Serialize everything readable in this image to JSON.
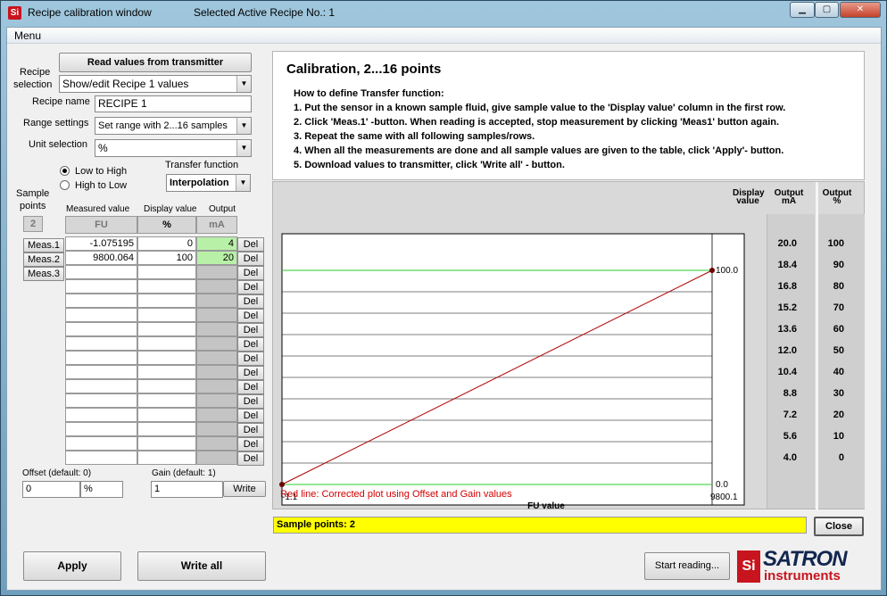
{
  "window": {
    "title": "Recipe calibration window",
    "active_recipe_label": "Selected Active Recipe No.: 1",
    "minimize": "▁",
    "maximize": "▢",
    "close": "✕"
  },
  "menu": {
    "label": "Menu"
  },
  "left": {
    "read_button": "Read values from transmitter",
    "recipe_selection_label_1": "Recipe",
    "recipe_selection_label_2": "selection",
    "recipe_selection_value": "Show/edit Recipe 1 values",
    "recipe_name_label": "Recipe name",
    "recipe_name_value": "RECIPE 1",
    "range_settings_label": "Range settings",
    "range_settings_value": "Set range with 2...16 samples",
    "unit_selection_label": "Unit selection",
    "unit_selection_value": "%",
    "low_to_high": "Low to High",
    "high_to_low": "High to Low",
    "direction_selected": "Low to High",
    "transfer_function_label": "Transfer function",
    "transfer_function_value": "Interpolation",
    "sample_points_label_1": "Sample",
    "sample_points_label_2": "points",
    "sample_points_count": "2",
    "col_measured": "Measured  value",
    "col_display": "Display value",
    "col_output": "Output",
    "unit_fu": "FU",
    "unit_percent": "%",
    "unit_ma": "mA",
    "meas_buttons": [
      "Meas.1",
      "Meas.2",
      "Meas.3"
    ],
    "rows": [
      {
        "measured": "-1.075195",
        "display": "0",
        "output": "4"
      },
      {
        "measured": "9800.064",
        "display": "100",
        "output": "20"
      }
    ],
    "empty_rows": 14,
    "del_label": "Del",
    "offset_label": "Offset (default: 0)",
    "offset_value": "0",
    "offset_unit": "%",
    "gain_label": "Gain (default: 1)",
    "gain_value": "1",
    "write_button": "Write",
    "apply_button": "Apply",
    "write_all_button": "Write all"
  },
  "instructions": {
    "title": "Calibration, 2...16 points",
    "heading": "How to define Transfer function:",
    "steps": [
      "1. Put the sensor in a known sample fluid, give sample value to the 'Display value' column in the first row.",
      "2. Click 'Meas.1' -button. When reading is accepted, stop measurement by clicking 'Meas1' button again.",
      "3. Repeat the same with all following samples/rows.",
      "4. When all the measurements are done and all sample values are given to the table, click 'Apply'- button.",
      "5. Download values to transmitter, click  'Write all' - button."
    ]
  },
  "chart_data": {
    "type": "line",
    "xlabel": "FU value",
    "x_min_label": "-1.1",
    "x_max_label": "9800.1",
    "y_min_label": "0.0",
    "y_max_label": "100.0",
    "xlim": [
      -1.1,
      9800.1
    ],
    "ylim": [
      0,
      100
    ],
    "series": [
      {
        "name": "Corrected plot",
        "color": "#b00000",
        "points": [
          [
            -1.1,
            0
          ],
          [
            9800.1,
            100
          ]
        ]
      }
    ],
    "grid_rows": 10,
    "col_display_header_1": "Display",
    "col_display_header_2": "value",
    "col_output_ma_header_1": "Output",
    "col_output_ma_header_2": "mA",
    "col_output_pct_header_1": "Output",
    "col_output_pct_header_2": "%",
    "output_ma": [
      "20.0",
      "18.4",
      "16.8",
      "15.2",
      "13.6",
      "12.0",
      "10.4",
      "8.8",
      "7.2",
      "5.6",
      "4.0"
    ],
    "output_pct": [
      "100",
      "90",
      "80",
      "70",
      "60",
      "50",
      "40",
      "30",
      "20",
      "10",
      "0"
    ],
    "note": "Red line: Corrected plot using  Offset and Gain values"
  },
  "status": {
    "sample_points_text": "Sample points: 2",
    "close_button": "Close",
    "start_reading_button": "Start reading..."
  },
  "logo": {
    "satron": "SATRON",
    "instruments": "instruments",
    "badge": "Si"
  },
  "colors": {
    "status_yellow": "#ffff00",
    "output_green": "#b8f0a8",
    "chart_line": "#b00000",
    "grid_line": "#2ecc2e"
  }
}
